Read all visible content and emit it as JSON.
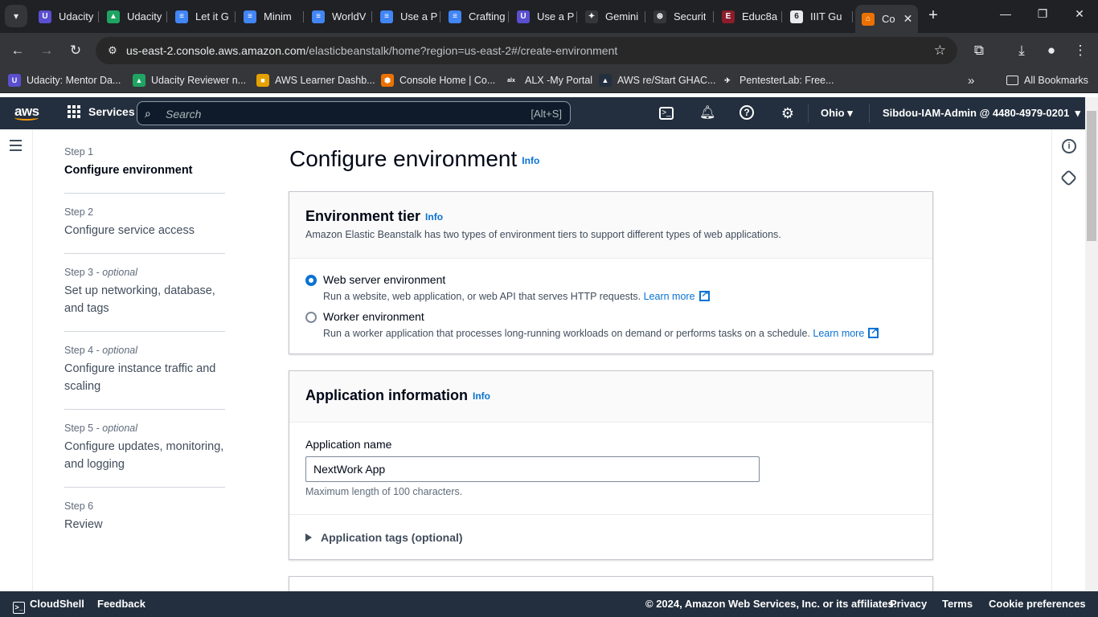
{
  "browser": {
    "tabs": [
      {
        "title": "Udacity",
        "icon": "udacity-icon",
        "color": "#5a4fcf",
        "glyph": "U"
      },
      {
        "title": "Udacity",
        "icon": "google-drive-icon",
        "color": "#1fa463",
        "glyph": "▲"
      },
      {
        "title": "Let it G",
        "icon": "google-docs-icon",
        "color": "#4285f4",
        "glyph": "≡"
      },
      {
        "title": "Minim",
        "icon": "google-docs-icon",
        "color": "#4285f4",
        "glyph": "≡"
      },
      {
        "title": "WorldV",
        "icon": "google-docs-icon",
        "color": "#4285f4",
        "glyph": "≡"
      },
      {
        "title": "Use a P",
        "icon": "google-docs-icon",
        "color": "#4285f4",
        "glyph": "≡"
      },
      {
        "title": "Crafting",
        "icon": "google-docs-icon",
        "color": "#4285f4",
        "glyph": "≡"
      },
      {
        "title": "Use a P",
        "icon": "udacity-icon",
        "color": "#5a4fcf",
        "glyph": "U"
      },
      {
        "title": "Gemini",
        "icon": "gemini-icon",
        "color": "#35363a",
        "glyph": "✦"
      },
      {
        "title": "Securit",
        "icon": "openai-icon",
        "color": "#35363a",
        "glyph": "⊛"
      },
      {
        "title": "Educ8a",
        "icon": "educ8a-icon",
        "color": "#8b1d2c",
        "glyph": "E"
      },
      {
        "title": "IIIT Gu",
        "icon": "iiit-icon",
        "color": "#e8eaed",
        "glyph": "6"
      },
      {
        "title": "Co",
        "icon": "aws-elastic-beanstalk-icon",
        "color": "#ed7100",
        "glyph": "⌂"
      }
    ],
    "url_host": "us-east-2.console.aws.amazon.com",
    "url_path": "/elasticbeanstalk/home?region=us-east-2#/create-environment",
    "bookmarks": [
      {
        "label": "Udacity: Mentor Da...",
        "icon": "udacity-icon",
        "color": "#5a4fcf",
        "glyph": "U"
      },
      {
        "label": "Udacity Reviewer n...",
        "icon": "google-drive-icon",
        "color": "#1fa463",
        "glyph": "▲"
      },
      {
        "label": "AWS Learner Dashb...",
        "icon": "aws-box-icon",
        "color": "#e5a100",
        "glyph": "■"
      },
      {
        "label": "Console Home | Co...",
        "icon": "aws-console-icon",
        "color": "#ed7100",
        "glyph": "⬢"
      },
      {
        "label": "ALX -My Portal",
        "icon": "alx-icon",
        "color": "#35363a",
        "glyph": "alx"
      },
      {
        "label": "AWS re/Start GHAC...",
        "icon": "aws-restart-icon",
        "color": "#232f3e",
        "glyph": "▲"
      },
      {
        "label": "PentesterLab: Free...",
        "icon": "pentesterlab-icon",
        "color": "#35363a",
        "glyph": "✈"
      }
    ],
    "all_bookmarks": "All Bookmarks"
  },
  "aws_header": {
    "logo": "aws",
    "services": "Services",
    "search_placeholder": "Search",
    "search_shortcut": "[Alt+S]",
    "region": "Ohio",
    "account": "Sibdou-IAM-Admin @ 4480-4979-0201"
  },
  "steps": [
    {
      "num": "Step 1",
      "optional": "",
      "title": "Configure environment"
    },
    {
      "num": "Step 2",
      "optional": "",
      "title": "Configure service access"
    },
    {
      "num": "Step 3",
      "optional": "optional",
      "title": "Set up networking, database, and tags"
    },
    {
      "num": "Step 4",
      "optional": "optional",
      "title": "Configure instance traffic and scaling"
    },
    {
      "num": "Step 5",
      "optional": "optional",
      "title": "Configure updates, monitoring, and logging"
    },
    {
      "num": "Step 6",
      "optional": "",
      "title": "Review"
    }
  ],
  "page": {
    "title": "Configure environment",
    "info": "Info"
  },
  "env_tier": {
    "title": "Environment tier",
    "info": "Info",
    "description": "Amazon Elastic Beanstalk has two types of environment tiers to support different types of web applications.",
    "options": [
      {
        "label": "Web server environment",
        "desc": "Run a website, web application, or web API that serves HTTP requests.",
        "link": "Learn more",
        "selected": true
      },
      {
        "label": "Worker environment",
        "desc": "Run a worker application that processes long-running workloads on demand or performs tasks on a schedule.",
        "link": "Learn more",
        "selected": false
      }
    ]
  },
  "app_info": {
    "title": "Application information",
    "info": "Info",
    "name_label": "Application name",
    "name_value": "NextWork App",
    "name_hint": "Maximum length of 100 characters.",
    "tags_label": "Application tags (optional)"
  },
  "footer": {
    "cloudshell": "CloudShell",
    "feedback": "Feedback",
    "copyright": "© 2024, Amazon Web Services, Inc. or its affiliates.",
    "privacy": "Privacy",
    "terms": "Terms",
    "cookies": "Cookie preferences"
  }
}
